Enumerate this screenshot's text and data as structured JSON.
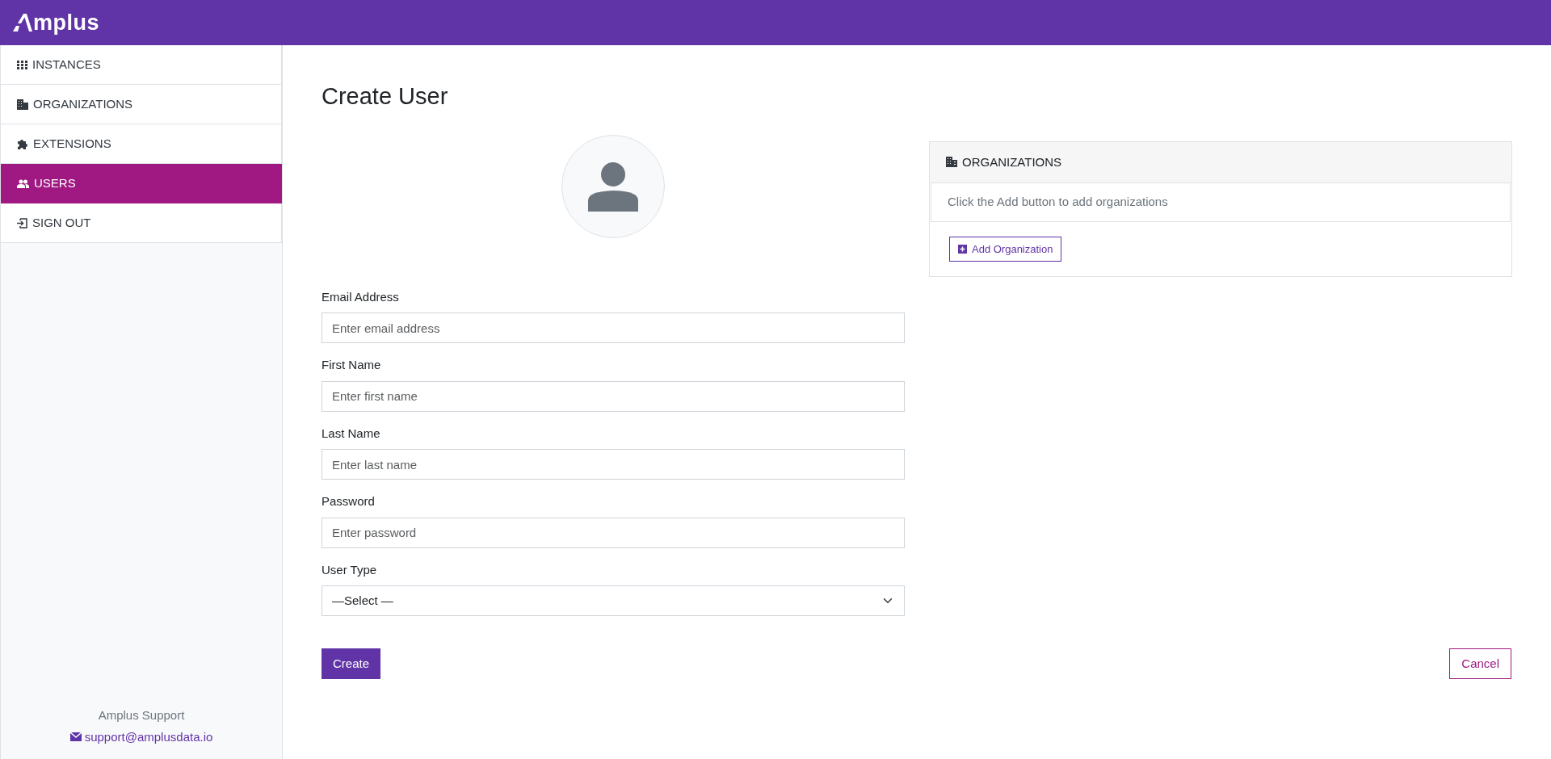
{
  "header": {
    "logo": "mplus"
  },
  "sidebar": {
    "items": [
      {
        "label": "INSTANCES",
        "kind": "grid",
        "selected": false
      },
      {
        "label": "ORGANIZATIONS",
        "kind": "building",
        "selected": false
      },
      {
        "label": "EXTENSIONS",
        "kind": "puzzle",
        "selected": false
      },
      {
        "label": "USERS",
        "kind": "users",
        "selected": true
      },
      {
        "label": "SIGN OUT",
        "kind": "signout",
        "selected": false
      }
    ],
    "support": {
      "title": "Amplus Support",
      "email": "support@amplusdata.io"
    }
  },
  "page": {
    "title": "Create User",
    "fields": [
      {
        "label": "Email Address",
        "kind": "input",
        "placeholder": "Enter email address"
      },
      {
        "label": "First Name",
        "kind": "input",
        "placeholder": "Enter first name"
      },
      {
        "label": "Last Name",
        "kind": "input",
        "placeholder": "Enter last name"
      },
      {
        "label": "Password",
        "kind": "input",
        "placeholder": "Enter password"
      },
      {
        "label": "User Type",
        "kind": "select",
        "value": "—Select —"
      }
    ],
    "create_button": "Create",
    "cancel_button": "Cancel"
  },
  "organizations_panel": {
    "title": "ORGANIZATIONS",
    "message": "Click the Add button to add organizations",
    "add_button": "Add Organization"
  }
}
